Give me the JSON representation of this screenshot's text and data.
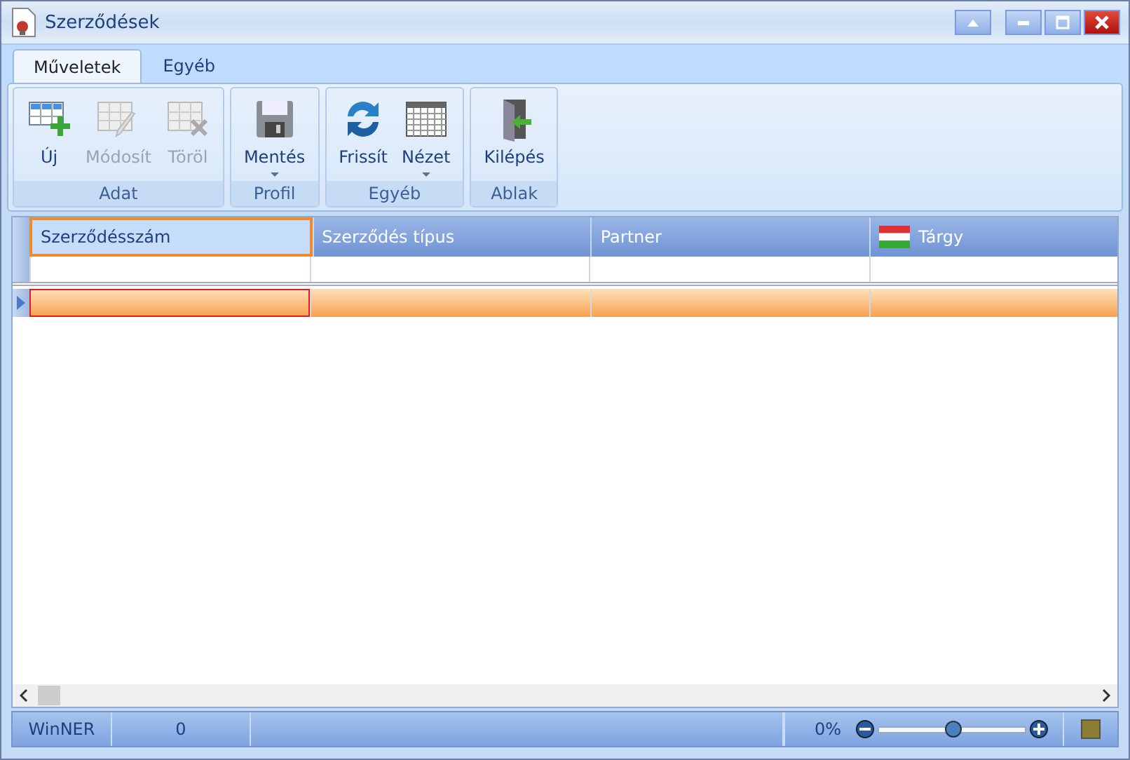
{
  "window": {
    "title": "Szerződések"
  },
  "tabs": [
    {
      "label": "Műveletek",
      "selected": true
    },
    {
      "label": "Egyéb",
      "selected": false
    }
  ],
  "ribbon_groups": [
    {
      "label": "Adat",
      "buttons": [
        {
          "label": "Új",
          "kind": "grid-add",
          "disabled": false,
          "dropdown": false
        },
        {
          "label": "Módosít",
          "kind": "grid-edit",
          "disabled": true,
          "dropdown": false
        },
        {
          "label": "Töröl",
          "kind": "grid-delete",
          "disabled": true,
          "dropdown": false
        }
      ]
    },
    {
      "label": "Profil",
      "buttons": [
        {
          "label": "Mentés",
          "kind": "floppy",
          "disabled": false,
          "dropdown": true
        }
      ]
    },
    {
      "label": "Egyéb",
      "buttons": [
        {
          "label": "Frissít",
          "kind": "refresh",
          "disabled": false,
          "dropdown": false
        },
        {
          "label": "Nézet",
          "kind": "table",
          "disabled": false,
          "dropdown": true
        }
      ]
    },
    {
      "label": "Ablak",
      "buttons": [
        {
          "label": "Kilépés",
          "kind": "exit",
          "disabled": false,
          "dropdown": false
        }
      ]
    }
  ],
  "table": {
    "columns": [
      {
        "label": "Szerződésszám",
        "selected": true,
        "flag": false
      },
      {
        "label": "Szerződés típus",
        "selected": false,
        "flag": false
      },
      {
        "label": "Partner",
        "selected": false,
        "flag": false
      },
      {
        "label": "Tárgy",
        "selected": false,
        "flag": true
      }
    ],
    "rows": [
      {
        "selected": true
      }
    ]
  },
  "status_bar": {
    "app": "WinNER",
    "count": "0",
    "zoom_text": "0%",
    "zoom": {
      "level": 0.5
    }
  }
}
